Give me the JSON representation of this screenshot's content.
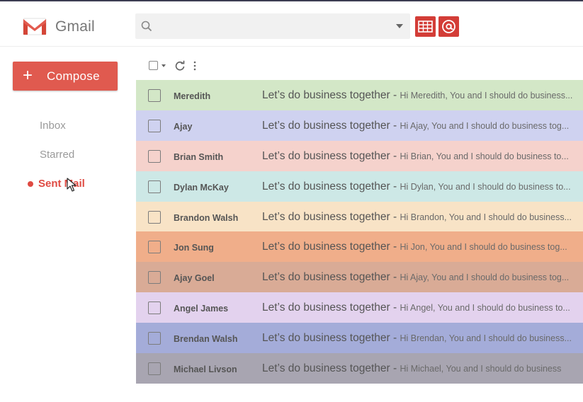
{
  "app": {
    "name": "Gmail"
  },
  "search": {
    "placeholder": "",
    "value": ""
  },
  "compose": {
    "icon": "+",
    "label": "Compose"
  },
  "nav": {
    "inbox": "Inbox",
    "starred": "Starred",
    "sent": "Sent Mail"
  },
  "colors": {
    "accent": "#df4a42",
    "compose": "#e05a4f"
  },
  "emails": [
    {
      "name": "Meredith",
      "subject": "Let’s do business together",
      "separator": " - ",
      "snippet": "Hi Meredith, You and I should do business...",
      "color": "#d3e7c7"
    },
    {
      "name": "Ajay",
      "subject": "Let’s do business together",
      "separator": " - ",
      "snippet": "Hi Ajay, You and I should do business tog...",
      "color": "#cfd2f0"
    },
    {
      "name": "Brian Smith",
      "subject": "Let’s do business together",
      "separator": " - ",
      "snippet": "Hi Brian, You and I should do business to...",
      "color": "#f5d2cc"
    },
    {
      "name": "Dylan McKay",
      "subject": "Let’s do business together",
      "separator": " - ",
      "snippet": "Hi Dylan, You and I should do business to...",
      "color": "#cde8e6"
    },
    {
      "name": "Brandon Walsh",
      "subject": "Let’s do business together",
      "separator": " - ",
      "snippet": "Hi Brandon, You and I should do business...",
      "color": "#f8e3c6"
    },
    {
      "name": "Jon Sung",
      "subject": "Let’s do business together",
      "separator": " - ",
      "snippet": "Hi Jon, You and I should do business tog...",
      "color": "#f0ae8a"
    },
    {
      "name": "Ajay Goel",
      "subject": "Let’s do business together",
      "separator": " - ",
      "snippet": "Hi Ajay, You and I should do business tog...",
      "color": "#d9ab96"
    },
    {
      "name": "Angel James",
      "subject": "Let’s do business together",
      "separator": " - ",
      "snippet": "Hi Angel, You and I should do business to...",
      "color": "#e3d2ee"
    },
    {
      "name": "Brendan Walsh",
      "subject": "Let’s do business together",
      "separator": " - ",
      "snippet": "Hi Brendan, You and I should do business...",
      "color": "#a4acd9"
    },
    {
      "name": "Michael Livson",
      "subject": "Let’s do business together",
      "separator": " - ",
      "snippet": "Hi Michael, You and I should do business",
      "color": "#a8a5b1"
    }
  ]
}
